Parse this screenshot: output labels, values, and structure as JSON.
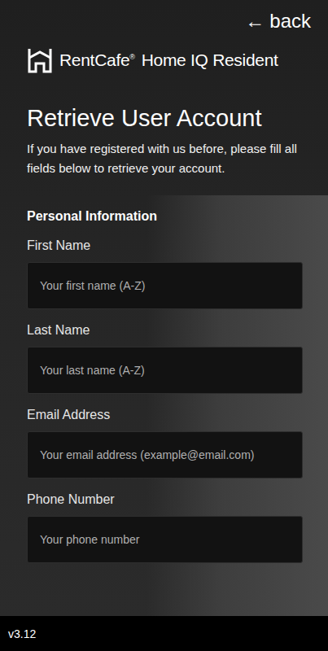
{
  "top_bar": {
    "back_icon": "←",
    "back_label": "back"
  },
  "logo": {
    "brand": "RentCafe",
    "registered": "®",
    "product": "Home IQ Resident"
  },
  "title": "Retrieve User Account",
  "subtitle": "If you have registered with us before, please fill all fields below to retrieve your account.",
  "section": {
    "title": "Personal Information"
  },
  "fields": [
    {
      "label": "First Name",
      "placeholder": "Your first name (A-Z)"
    },
    {
      "label": "Last Name",
      "placeholder": "Your last name (A-Z)"
    },
    {
      "label": "Email Address",
      "placeholder": "Your email address (example@email.com)"
    },
    {
      "label": "Phone Number",
      "placeholder": "Your phone number"
    }
  ],
  "footer": {
    "version": "v3.12"
  }
}
